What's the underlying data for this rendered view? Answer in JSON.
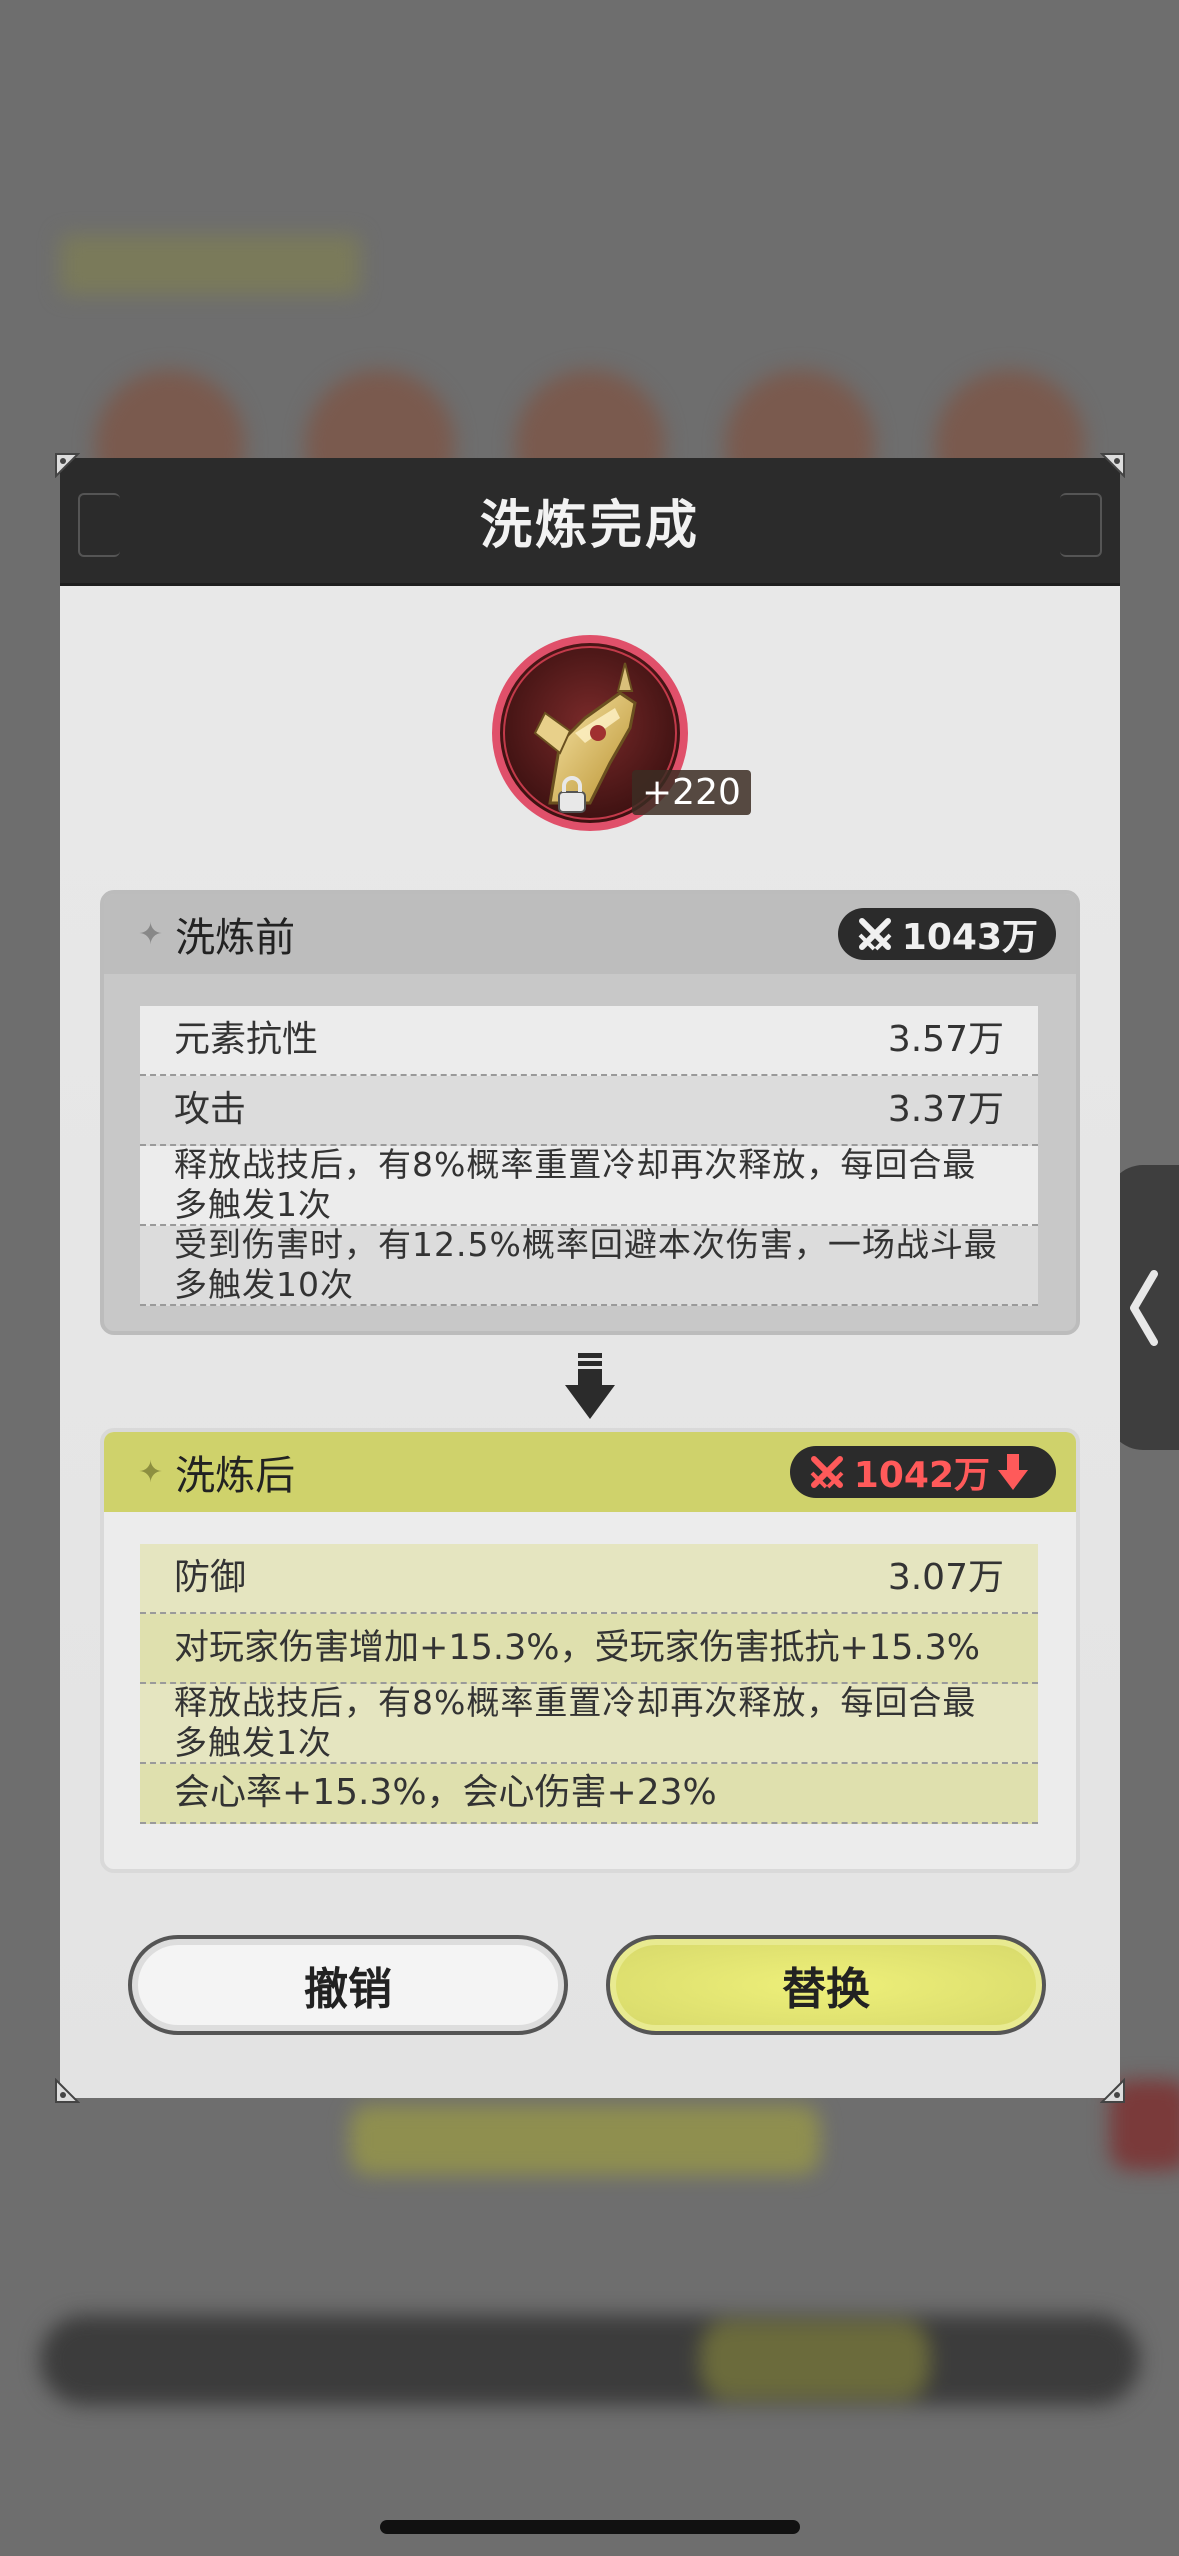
{
  "dialog": {
    "title": "洗炼完成",
    "item_level": "+220"
  },
  "before": {
    "title": "洗炼前",
    "power": "1043万",
    "stats": [
      {
        "name": "元素抗性",
        "value": "3.57万"
      },
      {
        "name": "攻击",
        "value": "3.37万"
      },
      {
        "name": "释放战技后，有8%概率重置冷却再次释放，每回合最多触发1次",
        "value": ""
      },
      {
        "name": "受到伤害时，有12.5%概率回避本次伤害，一场战斗最多触发10次",
        "value": ""
      }
    ]
  },
  "after": {
    "title": "洗炼后",
    "power": "1042万",
    "stats": [
      {
        "name": "防御",
        "value": "3.07万"
      },
      {
        "name": "对玩家伤害增加+15.3%，受玩家伤害抵抗+15.3%",
        "value": ""
      },
      {
        "name": "释放战技后，有8%概率重置冷却再次释放，每回合最多触发1次",
        "value": ""
      },
      {
        "name": "会心率+15.3%，会心伤害+23%",
        "value": ""
      }
    ]
  },
  "buttons": {
    "cancel": "撤销",
    "replace": "替换"
  },
  "colors": {
    "after_header": "#cfd26b",
    "power_down": "#ff5a5a",
    "ring": "#e0506a"
  }
}
